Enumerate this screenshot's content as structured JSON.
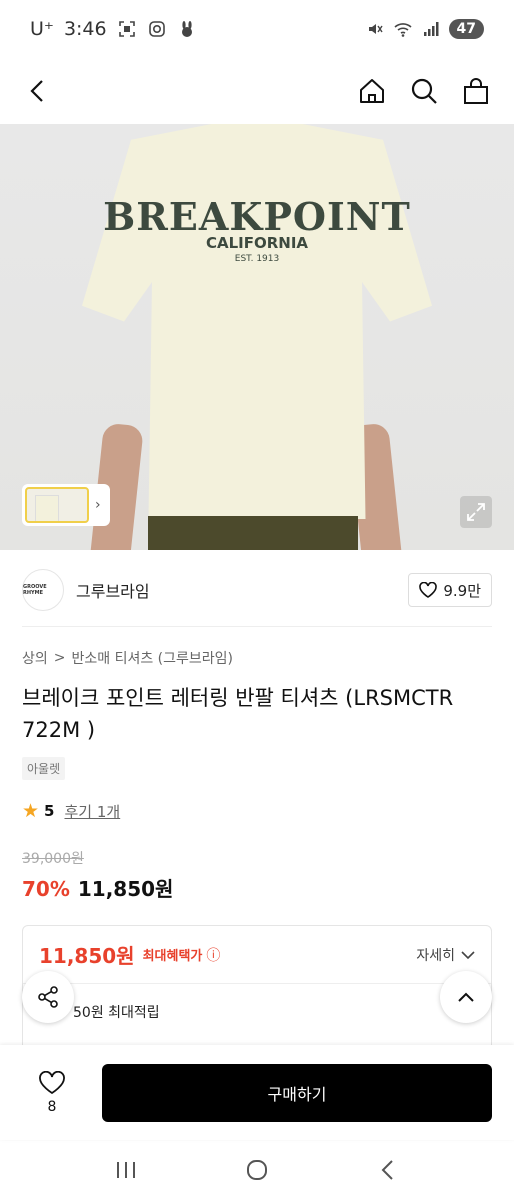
{
  "status_bar": {
    "carrier": "U⁺",
    "time": "3:46",
    "battery": "47"
  },
  "hero": {
    "print_line1": "BREAKPOINT",
    "print_line2": "CALIFORNIA",
    "print_line3": "EST. 1913"
  },
  "brand": {
    "logo_text": "GROOVE RHYME",
    "name": "그루브라임",
    "likes": "9.9만"
  },
  "breadcrumb": {
    "category": "상의",
    "separator": ">",
    "subcategory": "반소매 티셔츠 (그루브라임)"
  },
  "product": {
    "title": "브레이크 포인트 레터링 반팔 티셔츠 (LRSMCTR 722M )",
    "tag": "아울렛",
    "rating": "5",
    "review_label": "후기 1개",
    "original_price": "39,000원",
    "discount": "70%",
    "sale_price": "11,850원"
  },
  "benefit": {
    "price": "11,850원",
    "label": "최대혜택가",
    "detail_label": "자세히",
    "points_text": "50원 최대적립"
  },
  "bottom_bar": {
    "wish_count": "8",
    "buy_label": "구매하기"
  },
  "colors": {
    "accent_red": "#e8412c",
    "star": "#f5a623",
    "buy_button": "#000000"
  }
}
